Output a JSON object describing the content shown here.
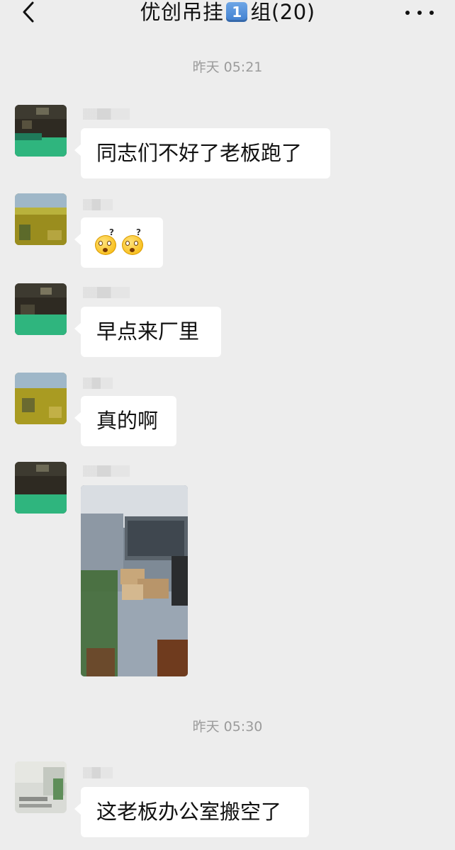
{
  "header": {
    "title_prefix": "优创吊挂",
    "title_keycap": "1",
    "title_suffix": "组(20)"
  },
  "icons": {
    "back": "chevron-left-icon",
    "more": "more-horizontal-icon"
  },
  "timestamps": [
    "昨天 05:21",
    "昨天 05:30"
  ],
  "messages": [
    {
      "type": "text",
      "text": "同志们不好了老板跑了"
    },
    {
      "type": "emoji",
      "emoji": [
        "flushed-question-emoji",
        "flushed-question-emoji"
      ]
    },
    {
      "type": "text",
      "text": "早点来厂里"
    },
    {
      "type": "text",
      "text": "真的啊"
    },
    {
      "type": "image",
      "image": "office-photo"
    },
    {
      "type": "text",
      "text": "这老板办公室搬空了"
    }
  ],
  "colors": {
    "background": "#ededed",
    "bubble": "#ffffff",
    "timestamp": "#9b9b9b"
  }
}
